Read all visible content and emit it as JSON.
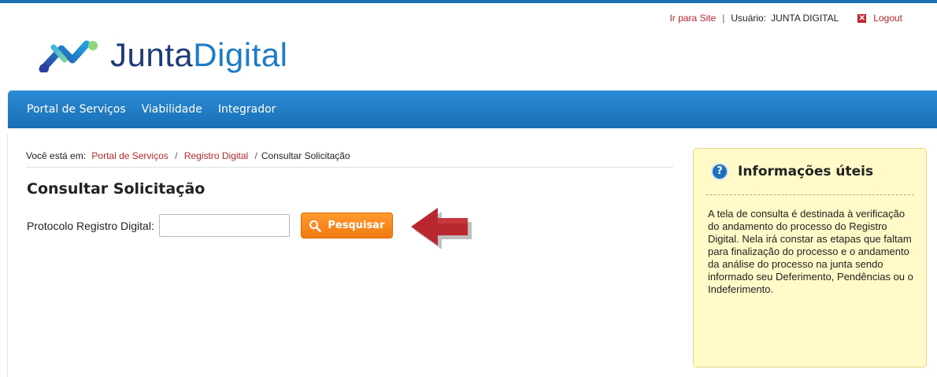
{
  "header": {
    "site_link": "Ir para Site",
    "separator": "|",
    "user_label": "Usuário:",
    "user_name": "JUNTA DIGITAL",
    "logout": "Logout"
  },
  "logo": {
    "part1": "Junta",
    "part2": "Digital"
  },
  "nav": {
    "items": [
      "Portal de Serviços",
      "Viabilidade",
      "Integrador"
    ]
  },
  "breadcrumb": {
    "prefix": "Você está em:",
    "items": [
      "Portal de Serviços",
      "Registro Digital"
    ],
    "current": "Consultar Solicitação",
    "sep": "/"
  },
  "page": {
    "title": "Consultar Solicitação",
    "protocol_label": "Protocolo Registro Digital:",
    "protocol_value": "",
    "search_button": "Pesquisar"
  },
  "info": {
    "title": "Informações úteis",
    "text": "A tela de consulta é destinada à verificação do andamento do processo do Registro Digital. Nela irá constar as etapas que faltam para finalização do processo e o andamento da análise do processo na junta sendo informado seu Deferimento, Pendências ou o Indeferimento."
  },
  "colors": {
    "brand_blue": "#1a6fb5",
    "link_red": "#c0262d",
    "button_orange": "#f58a1f",
    "info_bg": "#fffac8"
  }
}
